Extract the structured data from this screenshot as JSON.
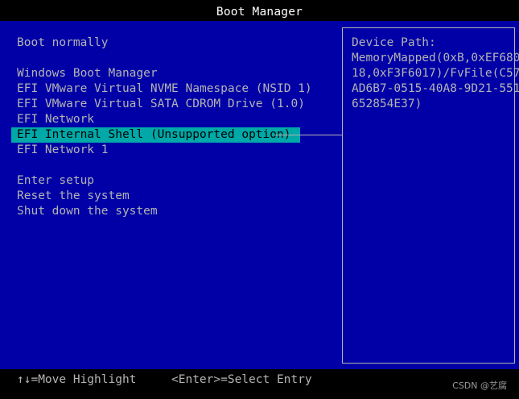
{
  "title": "Boot Manager",
  "menu": {
    "items": [
      "Boot normally",
      "Windows Boot Manager",
      "EFI VMware Virtual NVME Namespace (NSID 1)",
      "EFI VMware Virtual SATA CDROM Drive (1.0)",
      "EFI Network",
      "EFI Internal Shell (Unsupported option)",
      "EFI Network 1",
      "Enter setup",
      "Reset the system",
      "Shut down the system"
    ],
    "selected": "EFI Internal Shell (Unsupported option)"
  },
  "device_path": {
    "label": "Device Path:",
    "lines": [
      "MemoryMapped(0xB,0xEF680",
      "18,0xF3F6017)/FvFile(C57",
      "AD6B7-0515-40A8-9D21-551",
      "652854E37)"
    ]
  },
  "footer": {
    "move_hint": "↑↓=Move Highlight",
    "select_hint": "<Enter>=Select Entry",
    "watermark": "CSDN @艺腐"
  },
  "colors": {
    "background": "#0000a6",
    "highlight": "#00a8a8",
    "text": "#b4b4b4",
    "title_text": "#ffffff",
    "bars": "#000000"
  }
}
